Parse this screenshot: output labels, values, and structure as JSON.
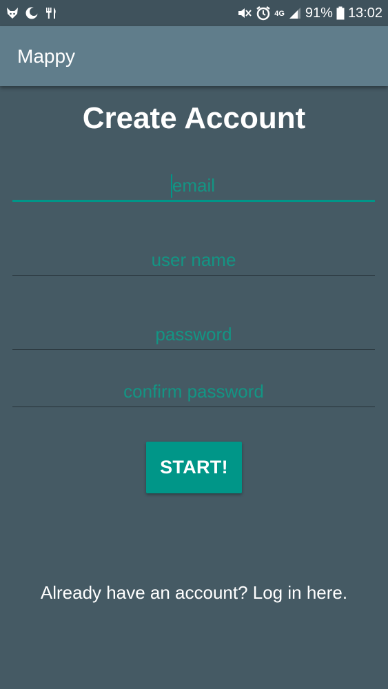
{
  "status_bar": {
    "left_icons": [
      "fox-icon",
      "moon-icon",
      "fork-knife-icon"
    ],
    "right_icons": [
      "vibrate-mute-icon",
      "alarm-icon",
      "4g-icon",
      "signal-icon",
      "battery-icon"
    ],
    "network": "4G",
    "battery": "91%",
    "time": "13:02"
  },
  "app_bar": {
    "title": "Mappy",
    "color": "#607d8b"
  },
  "form": {
    "title": "Create Account",
    "email_placeholder": "email",
    "username_placeholder": "user name",
    "password_placeholder": "password",
    "confirm_password_placeholder": "confirm password",
    "submit_label": "START!",
    "accent_color": "#009688"
  },
  "footer": {
    "login_link": "Already have an account? Log in here."
  },
  "colors": {
    "background": "#455a64",
    "status_bar": "#3f525c"
  }
}
